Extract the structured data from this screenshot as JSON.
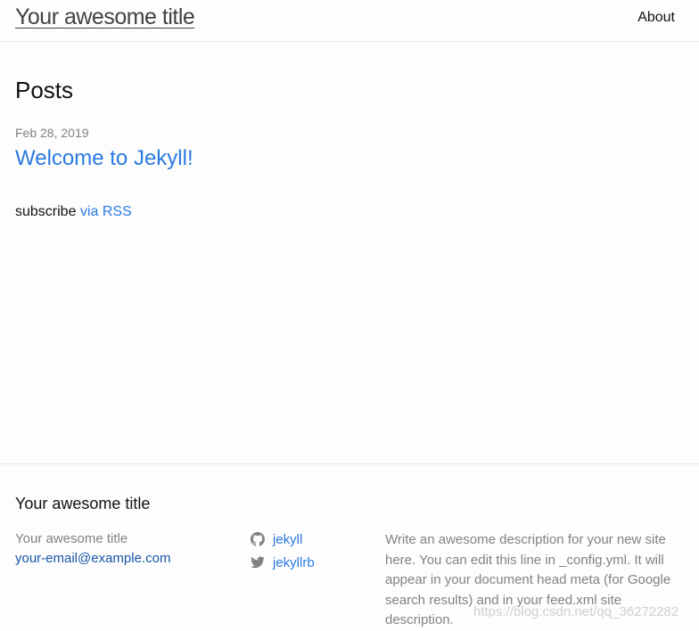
{
  "header": {
    "site_title": "Your awesome title",
    "nav": [
      {
        "label": "About"
      }
    ]
  },
  "main": {
    "heading": "Posts",
    "posts": [
      {
        "date": "Feb 28, 2019",
        "title": "Welcome to Jekyll!"
      }
    ],
    "rss_prefix": "subscribe",
    "rss_link": "via RSS"
  },
  "footer": {
    "heading": "Your awesome title",
    "name": "Your awesome title",
    "email": "your-email@example.com",
    "social": [
      {
        "icon": "github-icon",
        "label": "jekyll"
      },
      {
        "icon": "twitter-icon",
        "label": "jekyllrb"
      }
    ],
    "description": "Write an awesome description for your new site here. You can edit this line in _config.yml. It will appear in your document head meta (for Google search results) and in your feed.xml site description."
  },
  "watermark": "https://blog.csdn.net/qq_36272282"
}
